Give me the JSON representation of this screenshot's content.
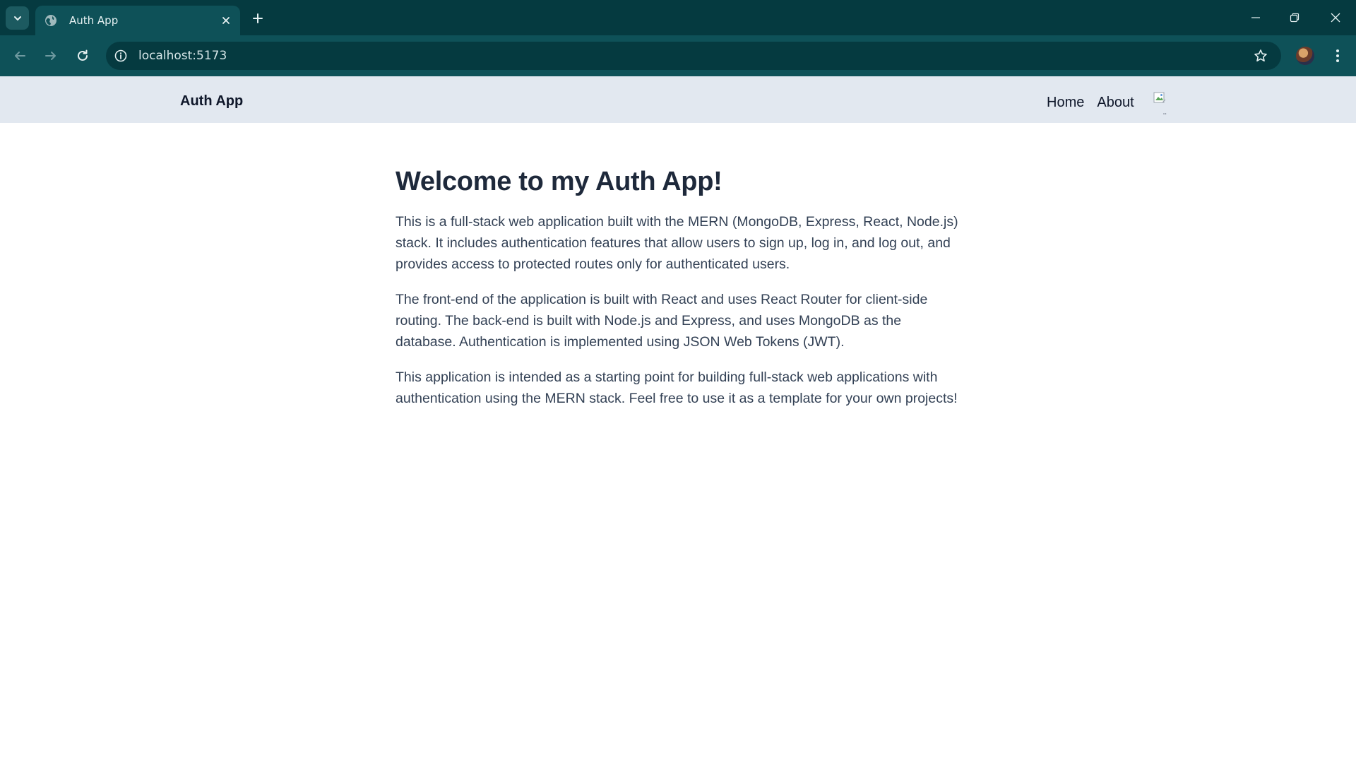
{
  "browser": {
    "tab_title": "Auth App",
    "url": "localhost:5173"
  },
  "site": {
    "brand": "Auth App",
    "nav": [
      "Home",
      "About"
    ]
  },
  "main": {
    "heading": "Welcome to my Auth App!",
    "paragraphs": [
      "This is a full-stack web application built with the MERN (MongoDB, Express, React, Node.js) stack. It includes authentication features that allow users to sign up, log in, and log out, and provides access to protected routes only for authenticated users.",
      "The front-end of the application is built with React and uses React Router for client-side routing. The back-end is built with Node.js and Express, and uses MongoDB as the database. Authentication is implemented using JSON Web Tokens (JWT).",
      "This application is intended as a starting point for building full-stack web applications with authentication using the MERN stack. Feel free to use it as a template for your own projects!"
    ]
  },
  "icons": {
    "tab_search": "chevron-down-icon",
    "favicon": "globe-icon",
    "tab_close": "close-icon",
    "new_tab": "plus-icon",
    "back": "arrow-left-icon",
    "forward": "arrow-right-icon",
    "reload": "reload-icon",
    "site_info": "info-icon",
    "bookmark": "star-icon",
    "menu": "kebab-menu-icon",
    "profile_image": "broken-image-icon"
  },
  "colors": {
    "chrome_dark": "#053a40",
    "chrome_toolbar": "#0e5158",
    "header_bg": "#e2e8f0",
    "heading": "#1e293b",
    "body_text": "#334155"
  }
}
